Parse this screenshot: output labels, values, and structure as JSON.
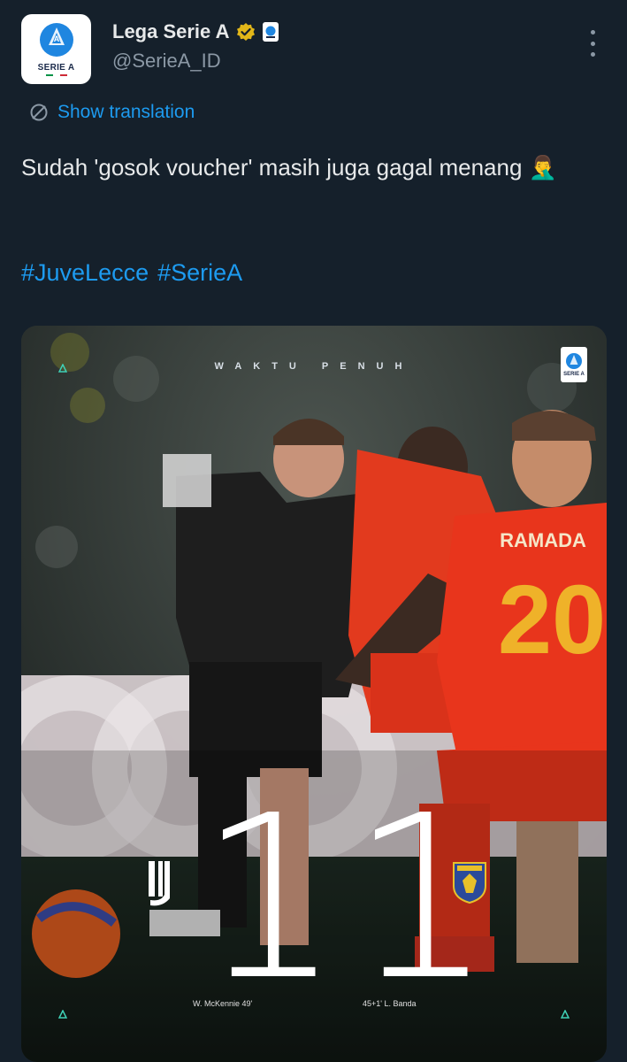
{
  "account": {
    "name": "Lega Serie A",
    "handle": "@SerieA_ID",
    "avatar_label": "SERIE A"
  },
  "translate": {
    "label": "Show translation"
  },
  "tweet": {
    "text": "Sudah 'gosok voucher' masih juga gagal menang 🤦‍♂️",
    "hashtags": [
      "#JuveLecce",
      "#SerieA"
    ]
  },
  "media": {
    "header": "WAKTU PENUH",
    "badge_label": "SERIE A",
    "home_score": "1",
    "away_score": "1",
    "home_scorer": "W. McKennie  49'",
    "away_scorer": "45+1'  L. Banda",
    "home_team_icon": "juventus-crest",
    "away_team_icon": "lecce-crest"
  },
  "colors": {
    "background": "#15202b",
    "link": "#1d9bf0",
    "verified": "#e2b719"
  }
}
